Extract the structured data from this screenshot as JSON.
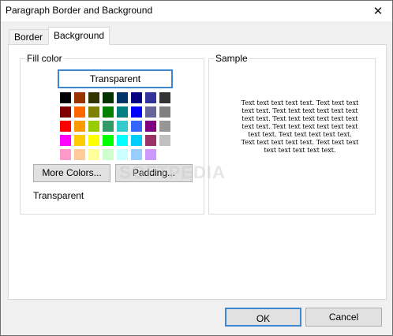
{
  "window": {
    "title": "Paragraph Border and Background",
    "close_icon": "close-icon"
  },
  "tabs": [
    {
      "label": "Border"
    },
    {
      "label": "Background"
    }
  ],
  "fill": {
    "group_label": "Fill color",
    "transparent_label": "Transparent",
    "more_colors_label": "More Colors...",
    "padding_label": "Padding...",
    "current_value": "Transparent",
    "swatches": [
      [
        "#000000",
        "#993300",
        "#333300",
        "#003300",
        "#003366",
        "#000080",
        "#333399",
        "#333333"
      ],
      [
        "#800000",
        "#FF6600",
        "#808000",
        "#008000",
        "#008080",
        "#0000FF",
        "#666699",
        "#808080"
      ],
      [
        "#FF0000",
        "#FF9900",
        "#99CC00",
        "#339966",
        "#33CCCC",
        "#3366FF",
        "#800080",
        "#969696"
      ],
      [
        "#FF00FF",
        "#FFCC00",
        "#FFFF00",
        "#00FF00",
        "#00FFFF",
        "#00CCFF",
        "#993366",
        "#C0C0C0"
      ],
      [
        "#FF99CC",
        "#FFCC99",
        "#FFFF99",
        "#CCFFCC",
        "#CCFFFF",
        "#99CCFF",
        "#CC99FF"
      ]
    ]
  },
  "sample": {
    "group_label": "Sample",
    "text": "Text text text text text. Text text text text text. Text text text text text text text text. Text text text text text text text text. Text text text text text text text text. Text text text text text. Text text text text text. Text text text text text text text text."
  },
  "watermark": "SOFTPEDIA",
  "buttons": {
    "ok": "OK",
    "cancel": "Cancel"
  }
}
